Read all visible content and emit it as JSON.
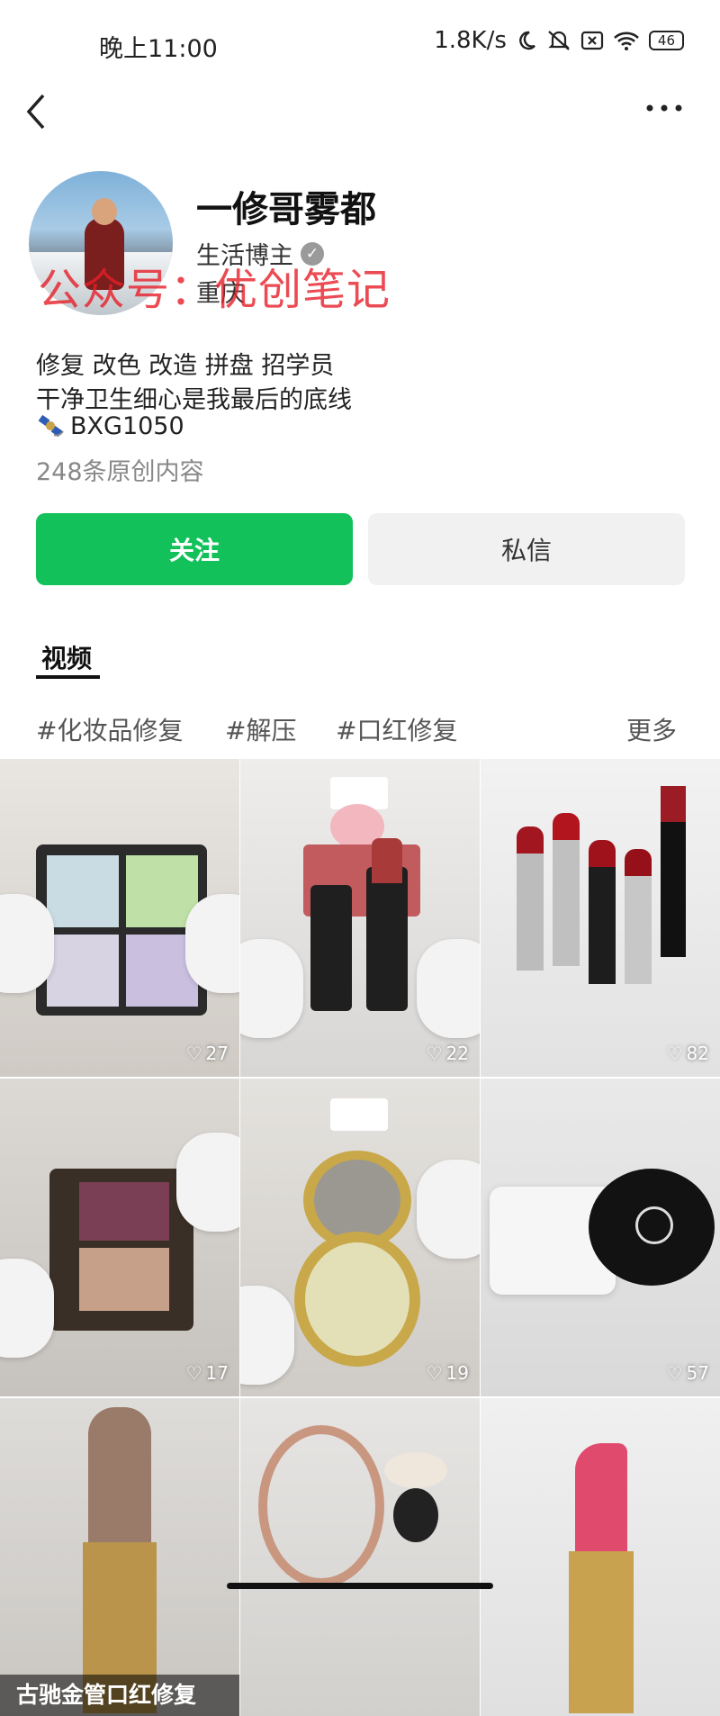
{
  "status_bar": {
    "time": "晚上11:00",
    "network_speed": "1.8K/s",
    "battery": "46",
    "icons": [
      "moon-icon",
      "mute-icon",
      "no-sim-icon",
      "wifi-icon",
      "battery-icon"
    ]
  },
  "header": {
    "back_icon": "chevron-left-icon",
    "more_icon": "more-dots-icon"
  },
  "profile": {
    "name": "一修哥雾都",
    "role": "生活博主",
    "city": "重庆",
    "watermark": "公众号：优创笔记",
    "bio_lines": [
      "修复 改色  改造  拼盘  招学员",
      "干净卫生细心是我最后的底线",
      "BXG1050"
    ],
    "original_count": "248条原创内容"
  },
  "actions": {
    "follow_label": "关注",
    "message_label": "私信",
    "accent_color": "#12c15a"
  },
  "tabs": {
    "active": "视频"
  },
  "tags": {
    "items": [
      "#化妆品修复",
      "#解压",
      "#口红修复"
    ],
    "more_label": "更多"
  },
  "videos": [
    {
      "likes": "27"
    },
    {
      "likes": "22"
    },
    {
      "likes": "82"
    },
    {
      "likes": "17"
    },
    {
      "likes": "19"
    },
    {
      "likes": "57"
    },
    {
      "caption": "古驰金管口红修复"
    },
    {},
    {}
  ]
}
